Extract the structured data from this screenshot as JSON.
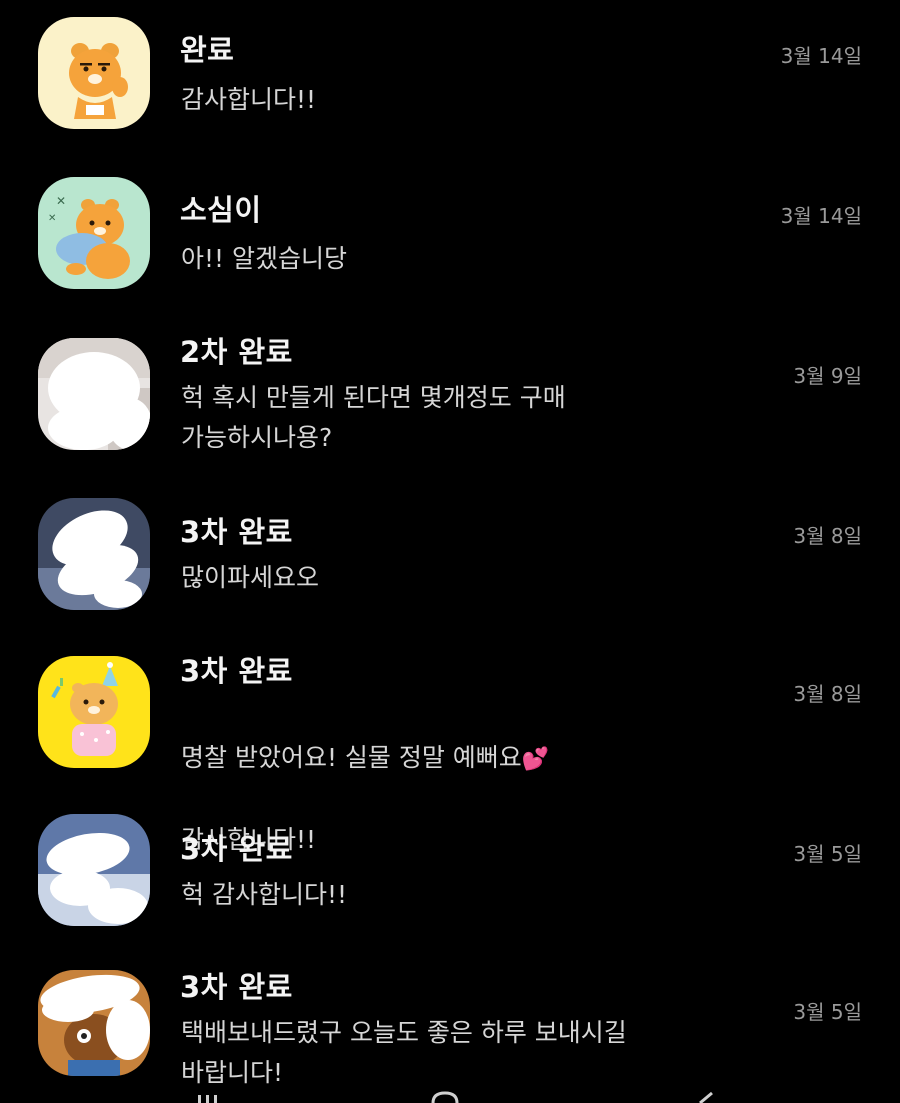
{
  "conversations": [
    {
      "name": "완료",
      "message": "감사합니다!!",
      "date": "3월 14일",
      "avatar": "ryan-yellow-icon"
    },
    {
      "name": "소심이",
      "message": "아!! 알겠습니당",
      "date": "3월 14일",
      "avatar": "ryan-pillow-mint-icon"
    },
    {
      "name": "2차 완료",
      "message": "헉 혹시 만들게 된다면 몇개정도 구매\n가능하시나용?",
      "date": "3월 9일",
      "avatar": "blurred-photo-avatar"
    },
    {
      "name": "3차 완료",
      "message": "많이파세요오",
      "date": "3월 8일",
      "avatar": "blurred-photo-avatar"
    },
    {
      "name": "3차 완료",
      "message_line1": "명찰 받았어요! 실물 정말 예뻐요",
      "message_emoji": "💕",
      "message_line2": "감사합니다!!",
      "date": "3월 8일",
      "avatar": "ryan-party-yellow-icon"
    },
    {
      "name": "3차 완료",
      "message": "헉 감사합니다!!",
      "date": "3월 5일",
      "avatar": "blurred-photo-avatar"
    },
    {
      "name": "3차 완료",
      "message": "택배보내드렸구 오늘도 좋은 하루 보내시길\n바랍니다!",
      "date": "3월 5일",
      "avatar": "blurred-character-avatar"
    }
  ],
  "colors": {
    "background": "#000000",
    "name": "#f4f4f4",
    "message": "#d6d6d6",
    "date": "#9a9a9a"
  }
}
